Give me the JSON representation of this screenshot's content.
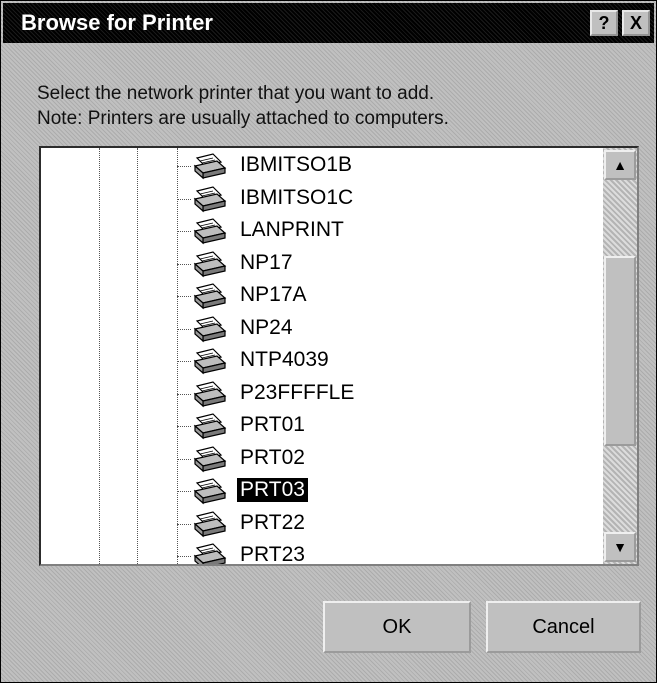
{
  "window": {
    "title": "Browse for Printer",
    "help_label": "?",
    "close_label": "X"
  },
  "prompt": {
    "line1": "Select the network printer that you want to add.",
    "line2": "Note: Printers are usually attached to computers."
  },
  "printers": [
    {
      "label": "IBMITSO1B",
      "icon": "printer-icon"
    },
    {
      "label": "IBMITSO1C",
      "icon": "printer-icon"
    },
    {
      "label": "LANPRINT",
      "icon": "printer-icon"
    },
    {
      "label": "NP17",
      "icon": "printer-icon"
    },
    {
      "label": "NP17A",
      "icon": "printer-icon"
    },
    {
      "label": "NP24",
      "icon": "printer-icon"
    },
    {
      "label": "NTP4039",
      "icon": "printer-icon"
    },
    {
      "label": "P23FFFFLE",
      "icon": "printer-icon"
    },
    {
      "label": "PRT01",
      "icon": "printer-icon"
    },
    {
      "label": "PRT02",
      "icon": "printer-icon"
    },
    {
      "label": "PRT03",
      "icon": "printer-icon",
      "selected": true
    },
    {
      "label": "PRT22",
      "icon": "printer-icon"
    },
    {
      "label": "PRT23",
      "icon": "printer-icon"
    }
  ],
  "scrollbar": {
    "up_icon": "scroll-up-arrow-icon",
    "down_icon": "scroll-down-arrow-icon",
    "up_glyph": "▲",
    "down_glyph": "▼"
  },
  "buttons": {
    "ok": "OK",
    "cancel": "Cancel"
  },
  "colors": {
    "selection_bg": "#000000",
    "selection_fg": "#ffffff",
    "dialog_bg": "#c0c0c0"
  }
}
